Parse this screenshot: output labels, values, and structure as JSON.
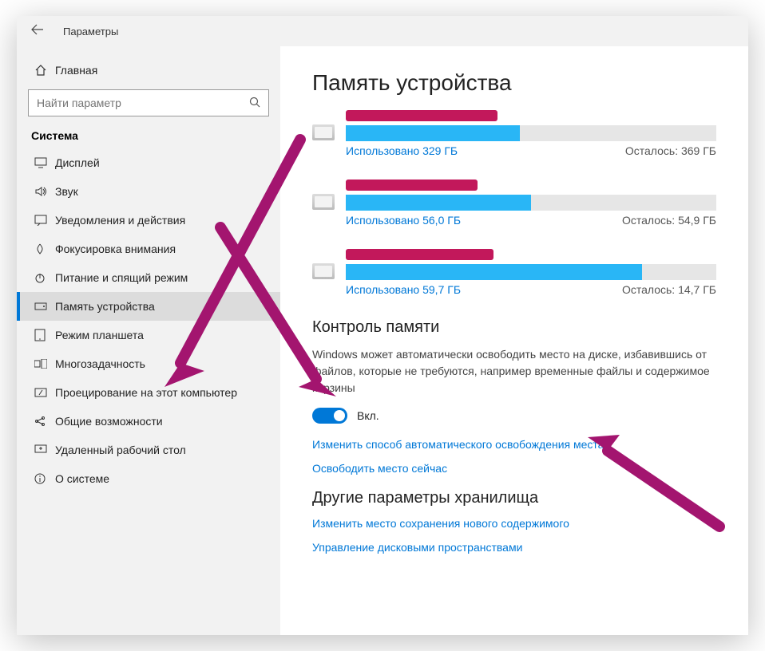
{
  "window": {
    "title": "Параметры"
  },
  "sidebar": {
    "home": "Главная",
    "search_placeholder": "Найти параметр",
    "category": "Система",
    "items": [
      {
        "label": "Дисплей"
      },
      {
        "label": "Звук"
      },
      {
        "label": "Уведомления и действия"
      },
      {
        "label": "Фокусировка внимания"
      },
      {
        "label": "Питание и спящий режим"
      },
      {
        "label": "Память устройства"
      },
      {
        "label": "Режим планшета"
      },
      {
        "label": "Многозадачность"
      },
      {
        "label": "Проецирование на этот компьютер"
      },
      {
        "label": "Общие возможности"
      },
      {
        "label": "Удаленный рабочий стол"
      },
      {
        "label": "О системе"
      }
    ]
  },
  "main": {
    "heading": "Память устройства",
    "drives": [
      {
        "used_label": "Использовано 329 ГБ",
        "free_label": "Осталось: 369 ГБ",
        "used_pct": 47
      },
      {
        "used_label": "Использовано 56,0 ГБ",
        "free_label": "Осталось: 54,9 ГБ",
        "used_pct": 50
      },
      {
        "used_label": "Использовано 59,7 ГБ",
        "free_label": "Осталось: 14,7 ГБ",
        "used_pct": 80
      }
    ],
    "storage_sense": {
      "title": "Контроль памяти",
      "desc": "Windows может автоматически освободить место на диске, избавившись от файлов, которые не требуются, например временные файлы и содержимое корзины",
      "toggle_state": "Вкл.",
      "link_change": "Изменить способ автоматического освобождения места",
      "link_free_now": "Освободить место сейчас"
    },
    "other": {
      "title": "Другие параметры хранилища",
      "link_save_loc": "Изменить место сохранения нового содержимого",
      "link_disk_spaces": "Управление дисковыми пространствами"
    }
  }
}
